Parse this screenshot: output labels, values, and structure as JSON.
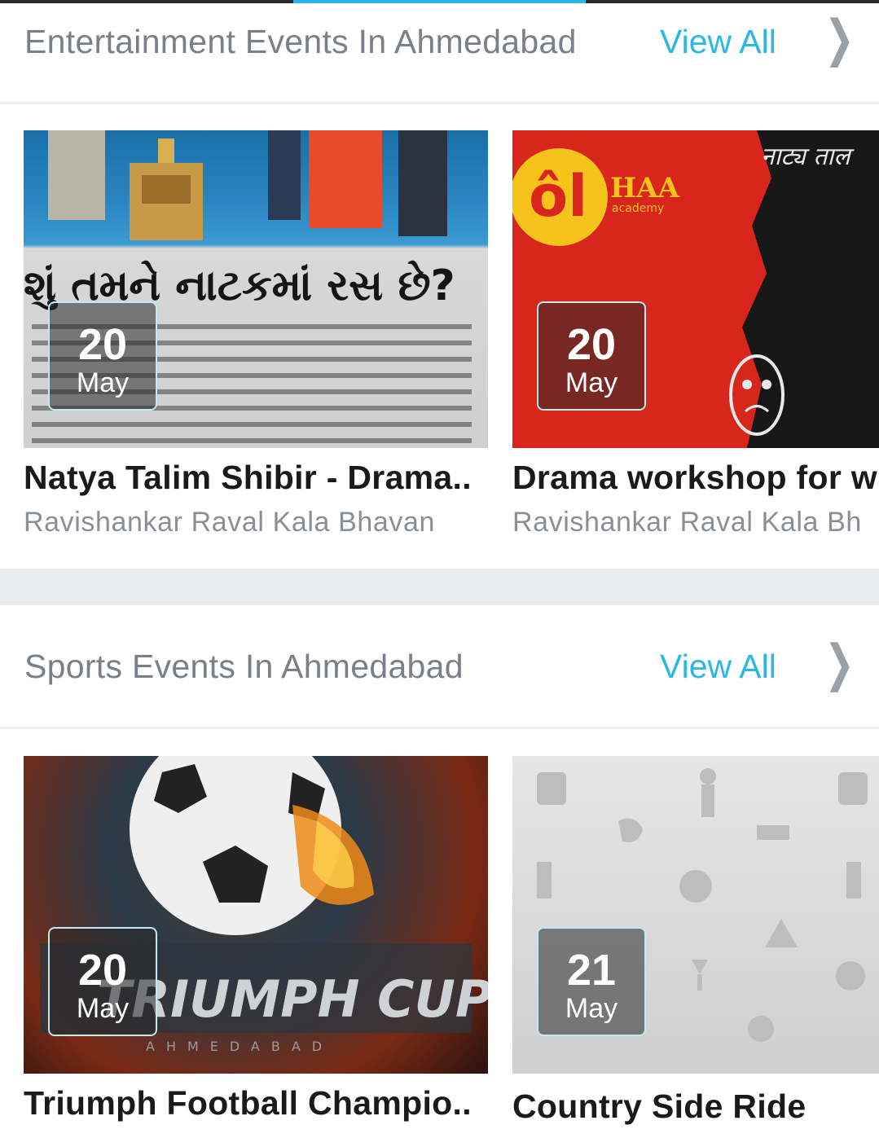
{
  "sections": [
    {
      "title": "Entertainment Events In Ahmedabad",
      "view_all": "View All",
      "chevron": "❯",
      "cards": [
        {
          "day": "20",
          "month": "May",
          "title": "Natya Talim Shibir - Drama..",
          "venue": "Ravishankar Raval Kala Bhavan",
          "image_text": "શું તમને નાટકમાં રસ છે?"
        },
        {
          "day": "20",
          "month": "May",
          "title": "Drama workshop for w",
          "venue": "Ravishankar Raval Kala Bh",
          "image_text": "HAA",
          "image_subtext": "academy",
          "image_text2": "नाट्य ताल"
        }
      ]
    },
    {
      "title": "Sports Events In Ahmedabad",
      "view_all": "View All",
      "chevron": "❯",
      "cards": [
        {
          "day": "20",
          "month": "May",
          "title": "Triumph Football Champio..",
          "venue": "",
          "image_text": "TRIUMPH CUP",
          "image_subtext": "AHMEDABAD"
        },
        {
          "day": "21",
          "month": "May",
          "title": "Country Side Ride",
          "venue": ""
        }
      ]
    }
  ],
  "colors": {
    "accent": "#2bb8e6",
    "title_gray": "#7b8088",
    "venue_gray": "#8a8f96",
    "separator": "#e9ebee"
  }
}
